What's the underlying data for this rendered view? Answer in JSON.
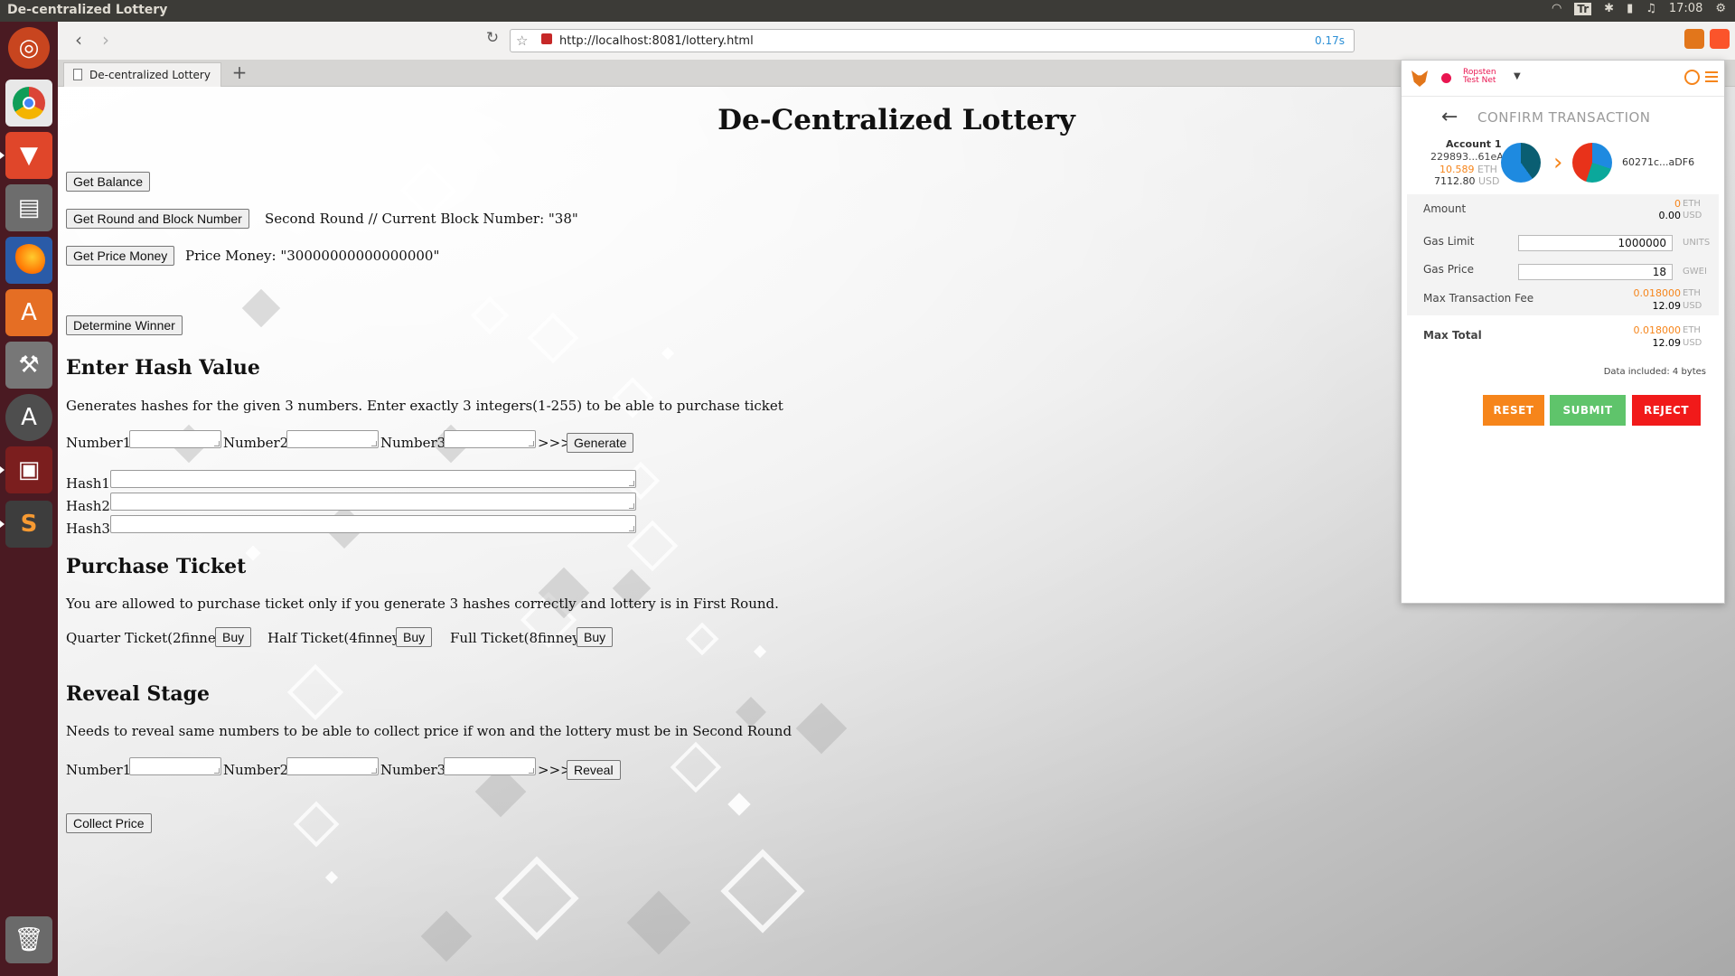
{
  "os": {
    "window_title": "De-centralized Lottery",
    "indicator_tr": "Tr",
    "clock": "17:08"
  },
  "browser": {
    "url": "http://localhost:8081/lottery.html",
    "load_time": "0.17s",
    "tab_title": "De-centralized Lottery",
    "new_tab": "+"
  },
  "page": {
    "title": "De-Centralized Lottery",
    "get_balance": "Get Balance",
    "get_round": "Get Round and Block Number",
    "round_status": "Second Round // Current Block Number: \"38\"",
    "get_price": "Get Price Money",
    "price_status": "Price Money: \"30000000000000000\"",
    "determine_winner": "Determine Winner",
    "hash_heading": "Enter Hash Value",
    "hash_desc": "Generates hashes for the given 3 numbers. Enter exactly 3 integers(1-255) to be able to purchase ticket",
    "number1_label": "Number1:",
    "number2_label": "Number2:",
    "number3_label": "Number3:",
    "arrow_sep": ">>>",
    "generate": "Generate",
    "hash1_label": "Hash1:",
    "hash2_label": "Hash2:",
    "hash3_label": "Hash3:",
    "purchase_heading": "Purchase Ticket",
    "purchase_desc": "You are allowed to purchase ticket only if you generate 3 hashes correctly and lottery is in First Round.",
    "quarter_label": "Quarter Ticket(2finney):",
    "half_label": "Half Ticket(4finney):",
    "full_label": "Full Ticket(8finney):",
    "buy": "Buy",
    "reveal_heading": "Reveal Stage",
    "reveal_desc": "Needs to reveal same numbers to be able to collect price if won and the lottery must be in Second Round",
    "reveal": "Reveal",
    "collect": "Collect Price"
  },
  "metamask": {
    "network_line1": "Ropsten",
    "network_line2": "Test Net",
    "title": "CONFIRM TRANSACTION",
    "from_name": "Account 1",
    "from_addr": "229893...61eA",
    "from_eth": "10.589",
    "from_usd": "7112.80",
    "to_addr": "60271c...aDF6",
    "eth_unit": "ETH",
    "usd_unit": "USD",
    "amount_label": "Amount",
    "amount_eth": "0",
    "amount_usd": "0.00",
    "gas_limit_label": "Gas Limit",
    "gas_limit": "1000000",
    "gas_limit_unit": "UNITS",
    "gas_price_label": "Gas Price",
    "gas_price": "18",
    "gas_price_unit": "GWEI",
    "max_fee_label": "Max Transaction Fee",
    "max_fee_eth": "0.018000",
    "max_fee_usd": "12.09",
    "max_total_label": "Max Total",
    "max_total_eth": "0.018000",
    "max_total_usd": "12.09",
    "data_included": "Data included: 4 bytes",
    "reset": "RESET",
    "submit": "SUBMIT",
    "reject": "REJECT"
  },
  "colors": {
    "launcher": "#4a1a22",
    "metamask_orange": "#f6851b",
    "submit_green": "#5fc46b",
    "reject_red": "#f11a1a",
    "network_pink": "#e91550"
  }
}
